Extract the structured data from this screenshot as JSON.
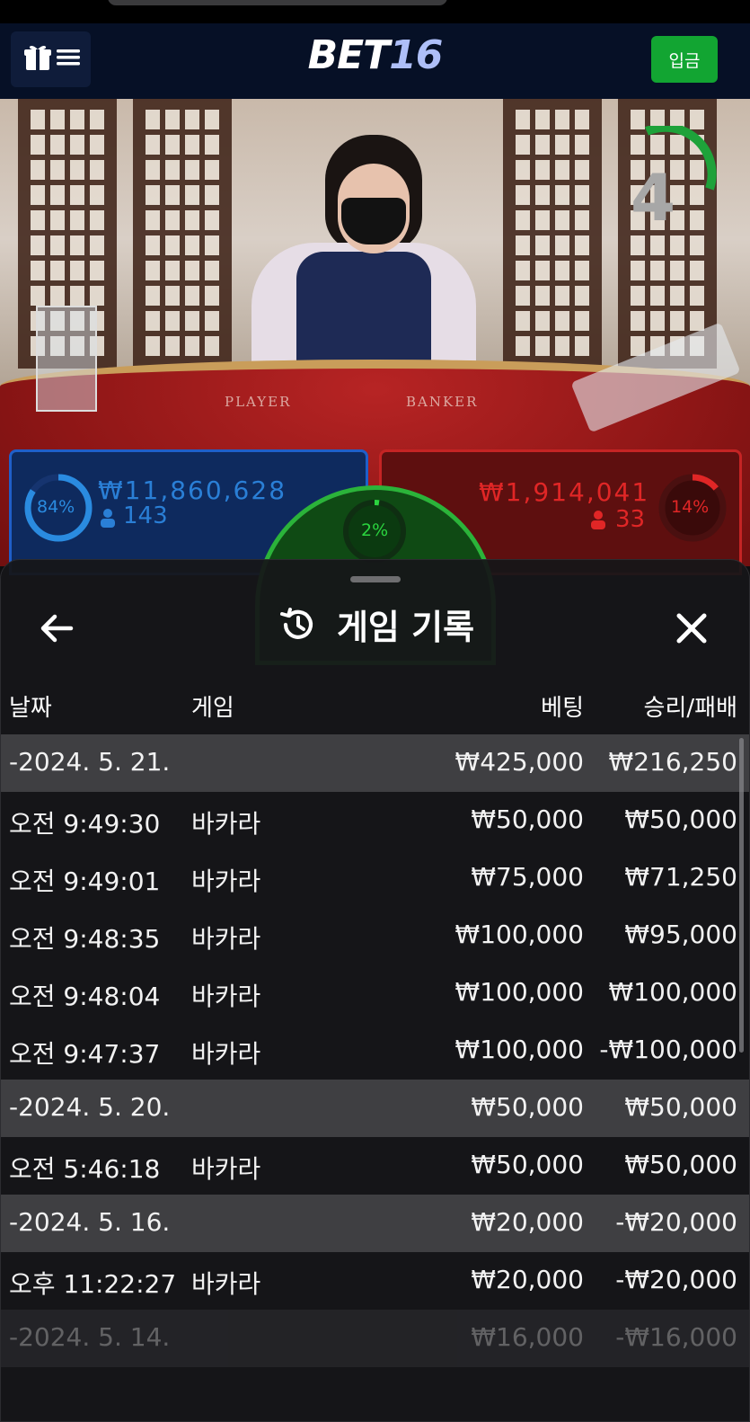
{
  "header": {
    "logo_part1": "BET",
    "logo_part2": "16",
    "deposit_label": "입금",
    "menu_icons": [
      "gift-icon",
      "hamburger-icon"
    ]
  },
  "table": {
    "player_word": "PLAYER",
    "banker_word": "BANKER",
    "timer": "4",
    "player": {
      "pct": "84%",
      "amount": "₩11,860,628",
      "count": "143"
    },
    "banker": {
      "pct": "14%",
      "amount": "₩1,914,041",
      "count": "33"
    },
    "tie": {
      "pct": "2%"
    }
  },
  "sheet": {
    "title": "게임 기록",
    "columns": {
      "date": "날짜",
      "game": "게임",
      "bet": "베팅",
      "win_loss": "승리/패배"
    },
    "rows": [
      {
        "type": "date",
        "time": "-2024. 5. 21.",
        "game": "",
        "bet": "₩425,000",
        "win": "₩216,250"
      },
      {
        "type": "item",
        "time": "오전 9:49:30",
        "game": "바카라",
        "bet": "₩50,000",
        "win": "₩50,000"
      },
      {
        "type": "item",
        "time": "오전 9:49:01",
        "game": "바카라",
        "bet": "₩75,000",
        "win": "₩71,250"
      },
      {
        "type": "item",
        "time": "오전 9:48:35",
        "game": "바카라",
        "bet": "₩100,000",
        "win": "₩95,000"
      },
      {
        "type": "item",
        "time": "오전 9:48:04",
        "game": "바카라",
        "bet": "₩100,000",
        "win": "₩100,000"
      },
      {
        "type": "item",
        "time": "오전 9:47:37",
        "game": "바카라",
        "bet": "₩100,000",
        "win": "-₩100,000"
      },
      {
        "type": "date",
        "time": "-2024. 5. 20.",
        "game": "",
        "bet": "₩50,000",
        "win": "₩50,000"
      },
      {
        "type": "item",
        "time": "오전 5:46:18",
        "game": "바카라",
        "bet": "₩50,000",
        "win": "₩50,000"
      },
      {
        "type": "date",
        "time": "-2024. 5. 16.",
        "game": "",
        "bet": "₩20,000",
        "win": "-₩20,000"
      },
      {
        "type": "item",
        "time": "오후 11:22:27",
        "game": "바카라",
        "bet": "₩20,000",
        "win": "-₩20,000"
      },
      {
        "type": "date",
        "time": "-2024. 5. 14.",
        "game": "",
        "bet": "₩16,000",
        "win": "-₩16,000"
      }
    ]
  },
  "colors": {
    "header_bg": "#061026",
    "deposit_green": "#12a532",
    "player_blue": "#1f5fc9",
    "banker_red": "#c52424",
    "tie_green": "#2bb33a",
    "sheet_bg": "#161618"
  }
}
